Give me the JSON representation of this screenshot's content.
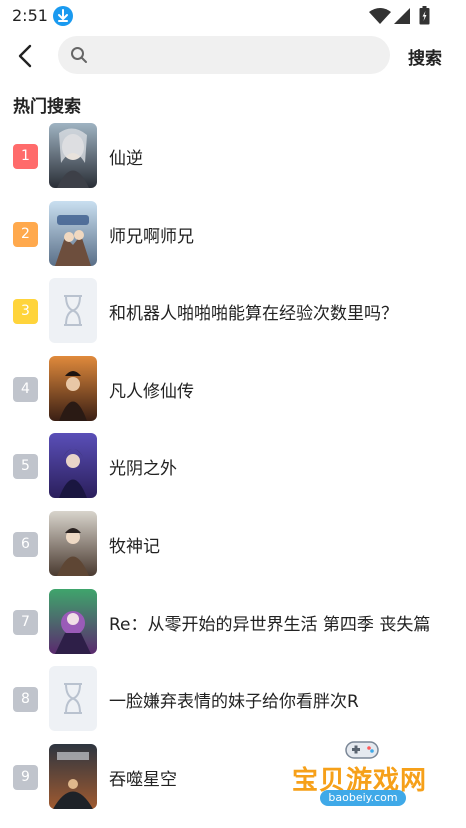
{
  "status_bar": {
    "time": "2:51",
    "icons": [
      "download-icon",
      "wifi-icon",
      "signal-icon",
      "battery-icon"
    ]
  },
  "header": {
    "search_placeholder": "",
    "search_value": "",
    "search_button_label": "搜索"
  },
  "section": {
    "title": "热门搜索"
  },
  "rank_colors": {
    "first": "#ff6b6b",
    "second": "#ffa94d",
    "third": "#ffd43b",
    "other": "#c0c4cc"
  },
  "hot_list": [
    {
      "rank": "1",
      "title": "仙逆",
      "thumb": "cover"
    },
    {
      "rank": "2",
      "title": "师兄啊师兄",
      "thumb": "cover"
    },
    {
      "rank": "3",
      "title": "和机器人啪啪啪能算在经验次数里吗？",
      "thumb": "placeholder"
    },
    {
      "rank": "4",
      "title": "凡人修仙传",
      "thumb": "cover"
    },
    {
      "rank": "5",
      "title": "光阴之外",
      "thumb": "cover"
    },
    {
      "rank": "6",
      "title": "牧神记",
      "thumb": "cover"
    },
    {
      "rank": "7",
      "title": "Re：从零开始的异世界生活 第四季 丧失篇",
      "thumb": "cover"
    },
    {
      "rank": "8",
      "title": "一脸嫌弃表情的妹子给你看胖次R",
      "thumb": "placeholder"
    },
    {
      "rank": "9",
      "title": "吞噬星空",
      "thumb": "cover"
    }
  ],
  "watermark": {
    "text": "宝贝游戏网",
    "url": "baobeiy.com"
  }
}
